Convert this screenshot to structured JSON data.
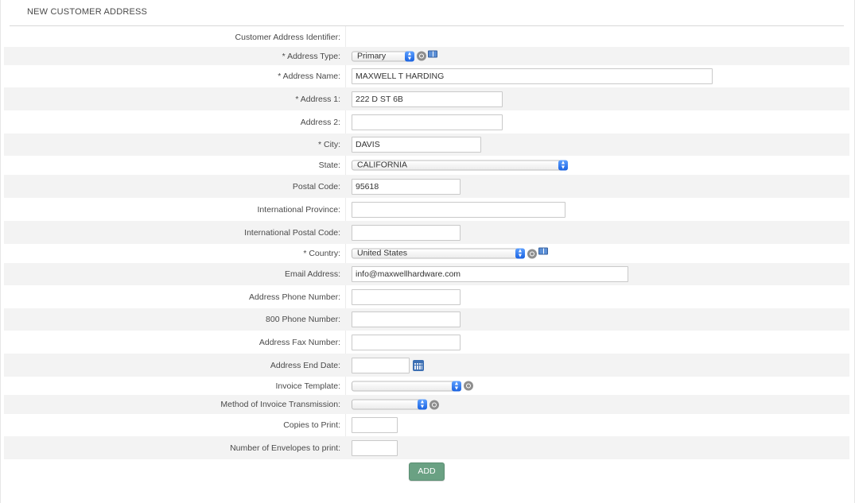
{
  "page": {
    "title": "NEW CUSTOMER ADDRESS"
  },
  "form": {
    "identifier_label": "Customer Address Identifier:",
    "address_type_label": "* Address Type:",
    "address_type_value": "Primary",
    "address_name_label": "* Address Name:",
    "address_name_value": "MAXWELL T HARDING",
    "address1_label": "* Address 1:",
    "address1_value": "222 D ST 6B",
    "address2_label": "Address 2:",
    "address2_value": "",
    "city_label": "* City:",
    "city_value": "DAVIS",
    "state_label": "State:",
    "state_value": "CALIFORNIA",
    "postal_label": "Postal Code:",
    "postal_value": "95618",
    "intl_province_label": "International Province:",
    "intl_province_value": "",
    "intl_postal_label": "International Postal Code:",
    "intl_postal_value": "",
    "country_label": "* Country:",
    "country_value": "United States",
    "email_label": "Email Address:",
    "email_value": "info@maxwellhardware.com",
    "phone_label": "Address Phone Number:",
    "phone_value": "",
    "phone800_label": "800 Phone Number:",
    "phone800_value": "",
    "fax_label": "Address Fax Number:",
    "fax_value": "",
    "end_date_label": "Address End Date:",
    "end_date_value": "",
    "invoice_template_label": "Invoice Template:",
    "invoice_template_value": "",
    "invoice_transmission_label": "Method of Invoice Transmission:",
    "invoice_transmission_value": "",
    "copies_label": "Copies to Print:",
    "copies_value": "",
    "envelopes_label": "Number of Envelopes to print:",
    "envelopes_value": ""
  },
  "actions": {
    "add_label": "ADD"
  },
  "colors": {
    "add_button": "#6aa183",
    "select_arrow": "#1a62e0",
    "alt_row": "#f3f3f3"
  }
}
